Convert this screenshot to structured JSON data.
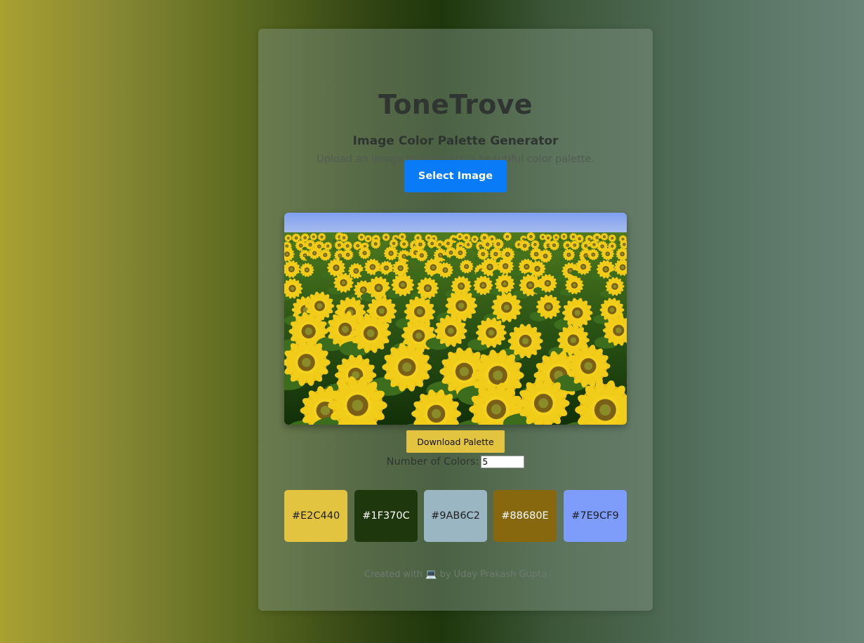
{
  "app": {
    "title": "ToneTrove",
    "subtitle": "Image Color Palette Generator",
    "description": "Upload an image to generate a beautiful color palette."
  },
  "controls": {
    "select_label": "Select Image",
    "download_label": "Download Palette",
    "count_label": "Number of Colors:",
    "count_value": "5"
  },
  "preview": {
    "icon": "sunflower-field-image"
  },
  "palette": [
    {
      "hex": "#E2C440",
      "text_color": "#1f1f1f"
    },
    {
      "hex": "#1F370C",
      "text_color": "#ffffff"
    },
    {
      "hex": "#9AB6C2",
      "text_color": "#1f1f1f"
    },
    {
      "hex": "#88680E",
      "text_color": "#ffffff"
    },
    {
      "hex": "#7E9CF9",
      "text_color": "#1f1f1f"
    }
  ],
  "footer": {
    "before": "Created with",
    "icon": "laptop-icon",
    "emoji": "💻",
    "after": "by Uday Prakash Gupta"
  },
  "colors": {
    "accent": "#0a7bf7",
    "download_button": "#e2c440"
  }
}
